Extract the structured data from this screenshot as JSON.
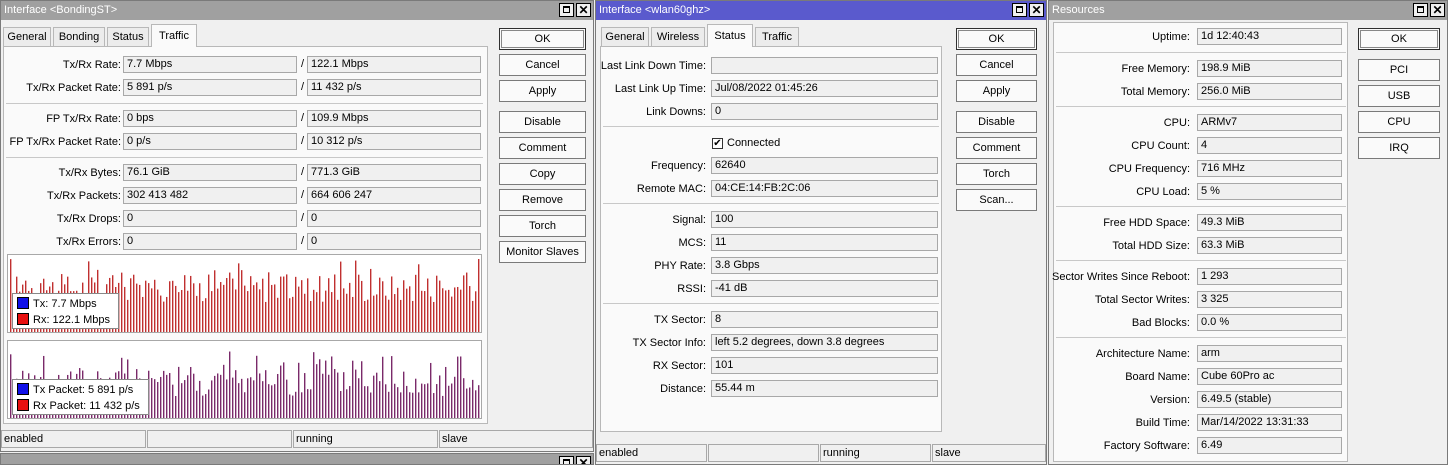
{
  "colors": {
    "tx": "#1010e8",
    "rx": "#e81010",
    "graph_line": "#c03030",
    "graph_packet": "#7a2a6a"
  },
  "bonding": {
    "title": "Interface <BondingST>",
    "tabs": [
      "General",
      "Bonding",
      "Status",
      "Traffic"
    ],
    "selected_tab": "Traffic",
    "rows": [
      {
        "label": "Tx/Rx Rate:",
        "tx": "7.7 Mbps",
        "rx": "122.1 Mbps"
      },
      {
        "label": "Tx/Rx Packet Rate:",
        "tx": "5 891 p/s",
        "rx": "11 432 p/s"
      },
      {
        "label": "FP Tx/Rx Rate:",
        "tx": "0 bps",
        "rx": "109.9 Mbps"
      },
      {
        "label": "FP Tx/Rx Packet Rate:",
        "tx": "0 p/s",
        "rx": "10 312 p/s"
      },
      {
        "label": "Tx/Rx Bytes:",
        "tx": "76.1 GiB",
        "rx": "771.3 GiB"
      },
      {
        "label": "Tx/Rx Packets:",
        "tx": "302 413 482",
        "rx": "664 606 247"
      },
      {
        "label": "Tx/Rx Drops:",
        "tx": "0",
        "rx": "0"
      },
      {
        "label": "Tx/Rx Errors:",
        "tx": "0",
        "rx": "0"
      }
    ],
    "slash": "/",
    "buttons": [
      "OK",
      "Cancel",
      "Apply",
      "Disable",
      "Comment",
      "Copy",
      "Remove",
      "Torch",
      "Monitor Slaves"
    ],
    "graph1_legend": {
      "tx": "Tx:  7.7 Mbps",
      "rx": "Rx:  122.1 Mbps"
    },
    "graph2_legend": {
      "tx": "Tx Packet:  5 891 p/s",
      "rx": "Rx Packet:  11 432 p/s"
    },
    "status": [
      "enabled",
      "",
      "running",
      "slave"
    ]
  },
  "wlan": {
    "title": "Interface <wlan60ghz>",
    "tabs": [
      "General",
      "Wireless",
      "Status",
      "Traffic"
    ],
    "selected_tab": "Status",
    "last_link_down_label": "Last Link Down Time:",
    "last_link_down": "",
    "last_link_up_label": "Last Link Up Time:",
    "last_link_up": "Jul/08/2022 01:45:26",
    "link_downs_label": "Link Downs:",
    "link_downs": "0",
    "connected_label": "Connected",
    "connected_checked": true,
    "frequency_label": "Frequency:",
    "frequency": "62640",
    "remote_mac_label": "Remote MAC:",
    "remote_mac": "04:CE:14:FB:2C:06",
    "signal_label": "Signal:",
    "signal": "100",
    "mcs_label": "MCS:",
    "mcs": "11",
    "phy_rate_label": "PHY Rate:",
    "phy_rate": "3.8 Gbps",
    "rssi_label": "RSSI:",
    "rssi": "-41 dB",
    "tx_sector_label": "TX Sector:",
    "tx_sector": "8",
    "tx_sector_info_label": "TX Sector Info:",
    "tx_sector_info": "left 5.2 degrees, down 3.8 degrees",
    "rx_sector_label": "RX Sector:",
    "rx_sector": "101",
    "distance_label": "Distance:",
    "distance": "55.44 m",
    "buttons": [
      "OK",
      "Cancel",
      "Apply",
      "Disable",
      "Comment",
      "Torch",
      "Scan..."
    ],
    "status": [
      "enabled",
      "",
      "running",
      "slave"
    ]
  },
  "resources": {
    "title": "Resources",
    "rows": [
      {
        "label": "Uptime:",
        "value": "1d 12:40:43"
      },
      {
        "label": "Free Memory:",
        "value": "198.9 MiB"
      },
      {
        "label": "Total Memory:",
        "value": "256.0 MiB"
      },
      {
        "label": "CPU:",
        "value": "ARMv7"
      },
      {
        "label": "CPU Count:",
        "value": "4"
      },
      {
        "label": "CPU Frequency:",
        "value": "716 MHz"
      },
      {
        "label": "CPU Load:",
        "value": "5 %"
      },
      {
        "label": "Free HDD Space:",
        "value": "49.3 MiB"
      },
      {
        "label": "Total HDD Size:",
        "value": "63.3 MiB"
      },
      {
        "label": "Sector Writes Since Reboot:",
        "value": "1 293"
      },
      {
        "label": "Total Sector Writes:",
        "value": "3 325"
      },
      {
        "label": "Bad Blocks:",
        "value": "0.0 %"
      },
      {
        "label": "Architecture Name:",
        "value": "arm"
      },
      {
        "label": "Board Name:",
        "value": "Cube 60Pro ac"
      },
      {
        "label": "Version:",
        "value": "6.49.5 (stable)"
      },
      {
        "label": "Build Time:",
        "value": "Mar/14/2022 13:31:33"
      },
      {
        "label": "Factory Software:",
        "value": "6.49"
      }
    ],
    "buttons": [
      "OK",
      "PCI",
      "USB",
      "CPU",
      "IRQ"
    ]
  }
}
